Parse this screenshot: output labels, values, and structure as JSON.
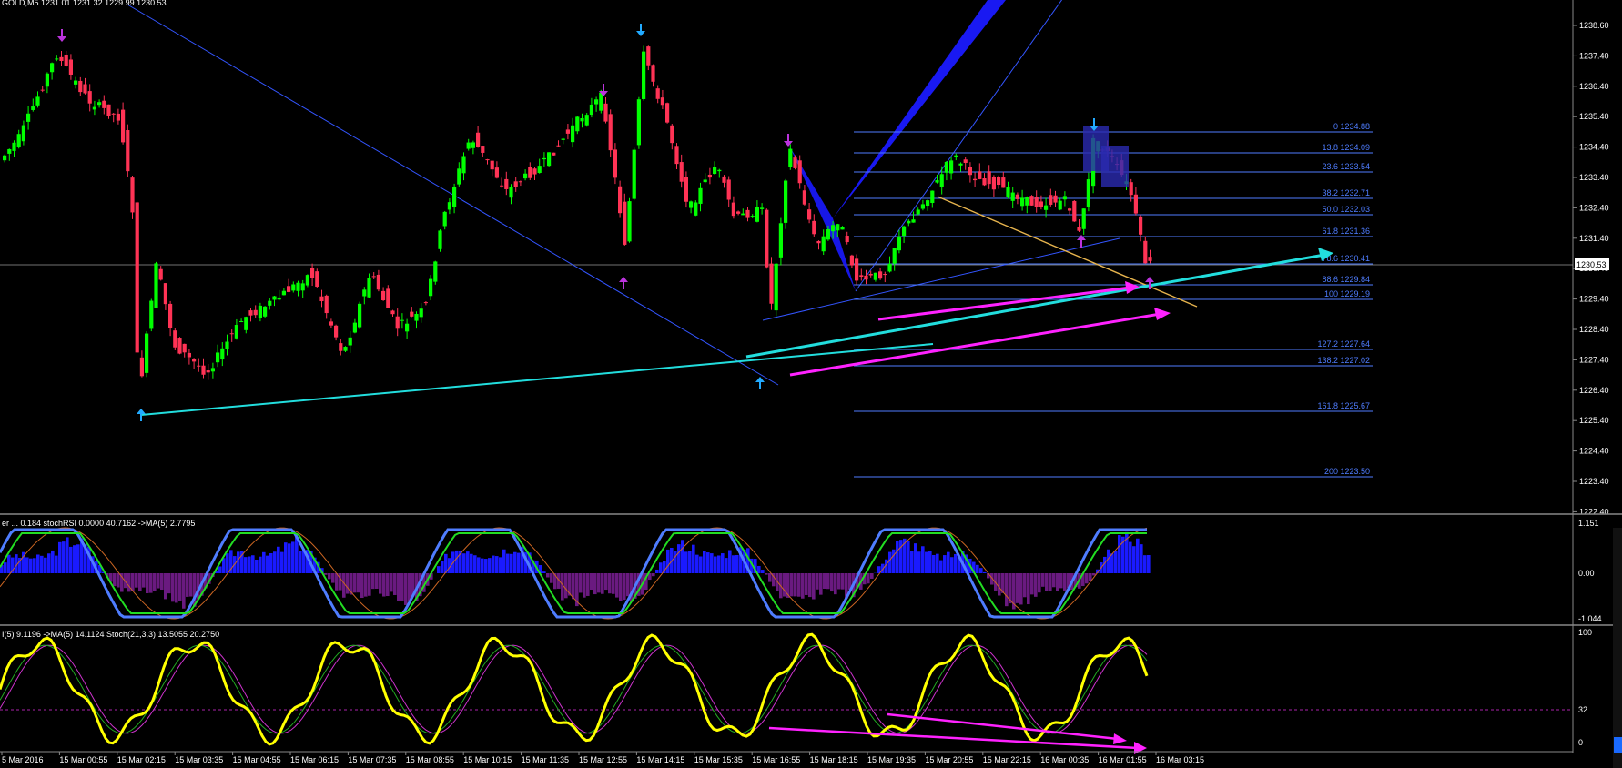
{
  "main_panel": {
    "header": "GOLD,M5  1231.01 1231.32 1229.99 1230.53",
    "price_ticks": [
      "1238.60",
      "1237.40",
      "1236.40",
      "1235.40",
      "1234.40",
      "1233.40",
      "1232.40",
      "1231.40",
      "1230.40",
      "1229.40",
      "1228.40",
      "1227.40",
      "1226.40",
      "1225.40",
      "1224.40",
      "1223.40",
      "1222.40"
    ],
    "current_price": "1230.53",
    "fib_levels": [
      {
        "label": "0 1234.88"
      },
      {
        "label": "13.8 1234.09"
      },
      {
        "label": "23.6 1233.54"
      },
      {
        "label": "38.2 1232.71"
      },
      {
        "label": "50.0 1232.03"
      },
      {
        "label": "61.8 1231.36"
      },
      {
        "label": "78.6 1230.41"
      },
      {
        "label": "88.6 1229.84"
      },
      {
        "label": "100 1229.19"
      },
      {
        "label": "127.2 1227.64"
      },
      {
        "label": "138.2 1227.02"
      },
      {
        "label": "161.8 1225.67"
      },
      {
        "label": "200 1223.50"
      }
    ]
  },
  "stoch_rsi_panel": {
    "header": "er ... 0.184  stochRSI 0.0000 40.7162  ->MA(5) 2.7795",
    "ticks": [
      "1.151",
      "0.00",
      "-1.044"
    ]
  },
  "stoch_panel": {
    "header": "I(5) 9.1196  ->MA(5) 14.1124  Stoch(21,3,3) 13.5055 20.2750",
    "ticks": [
      "100",
      "32",
      "0"
    ]
  },
  "time_axis": [
    "5 Mar 2016",
    "15 Mar 00:55",
    "15 Mar 02:15",
    "15 Mar 03:35",
    "15 Mar 04:55",
    "15 Mar 06:15",
    "15 Mar 07:35",
    "15 Mar 08:55",
    "15 Mar 10:15",
    "15 Mar 11:35",
    "15 Mar 12:55",
    "15 Mar 14:15",
    "15 Mar 15:35",
    "15 Mar 16:55",
    "15 Mar 18:15",
    "15 Mar 19:35",
    "15 Mar 20:55",
    "15 Mar 22:15",
    "16 Mar 00:35",
    "16 Mar 01:55",
    "16 Mar 03:15"
  ],
  "colors": {
    "bull": "#00ff00",
    "bear": "#ff3355",
    "fib": "#4f7dff",
    "cyan": "#22dddd",
    "magenta": "#ff22ff",
    "blue_pattern": "#1a1aff",
    "orange": "#e6b34d",
    "yellow": "#ffff00"
  }
}
